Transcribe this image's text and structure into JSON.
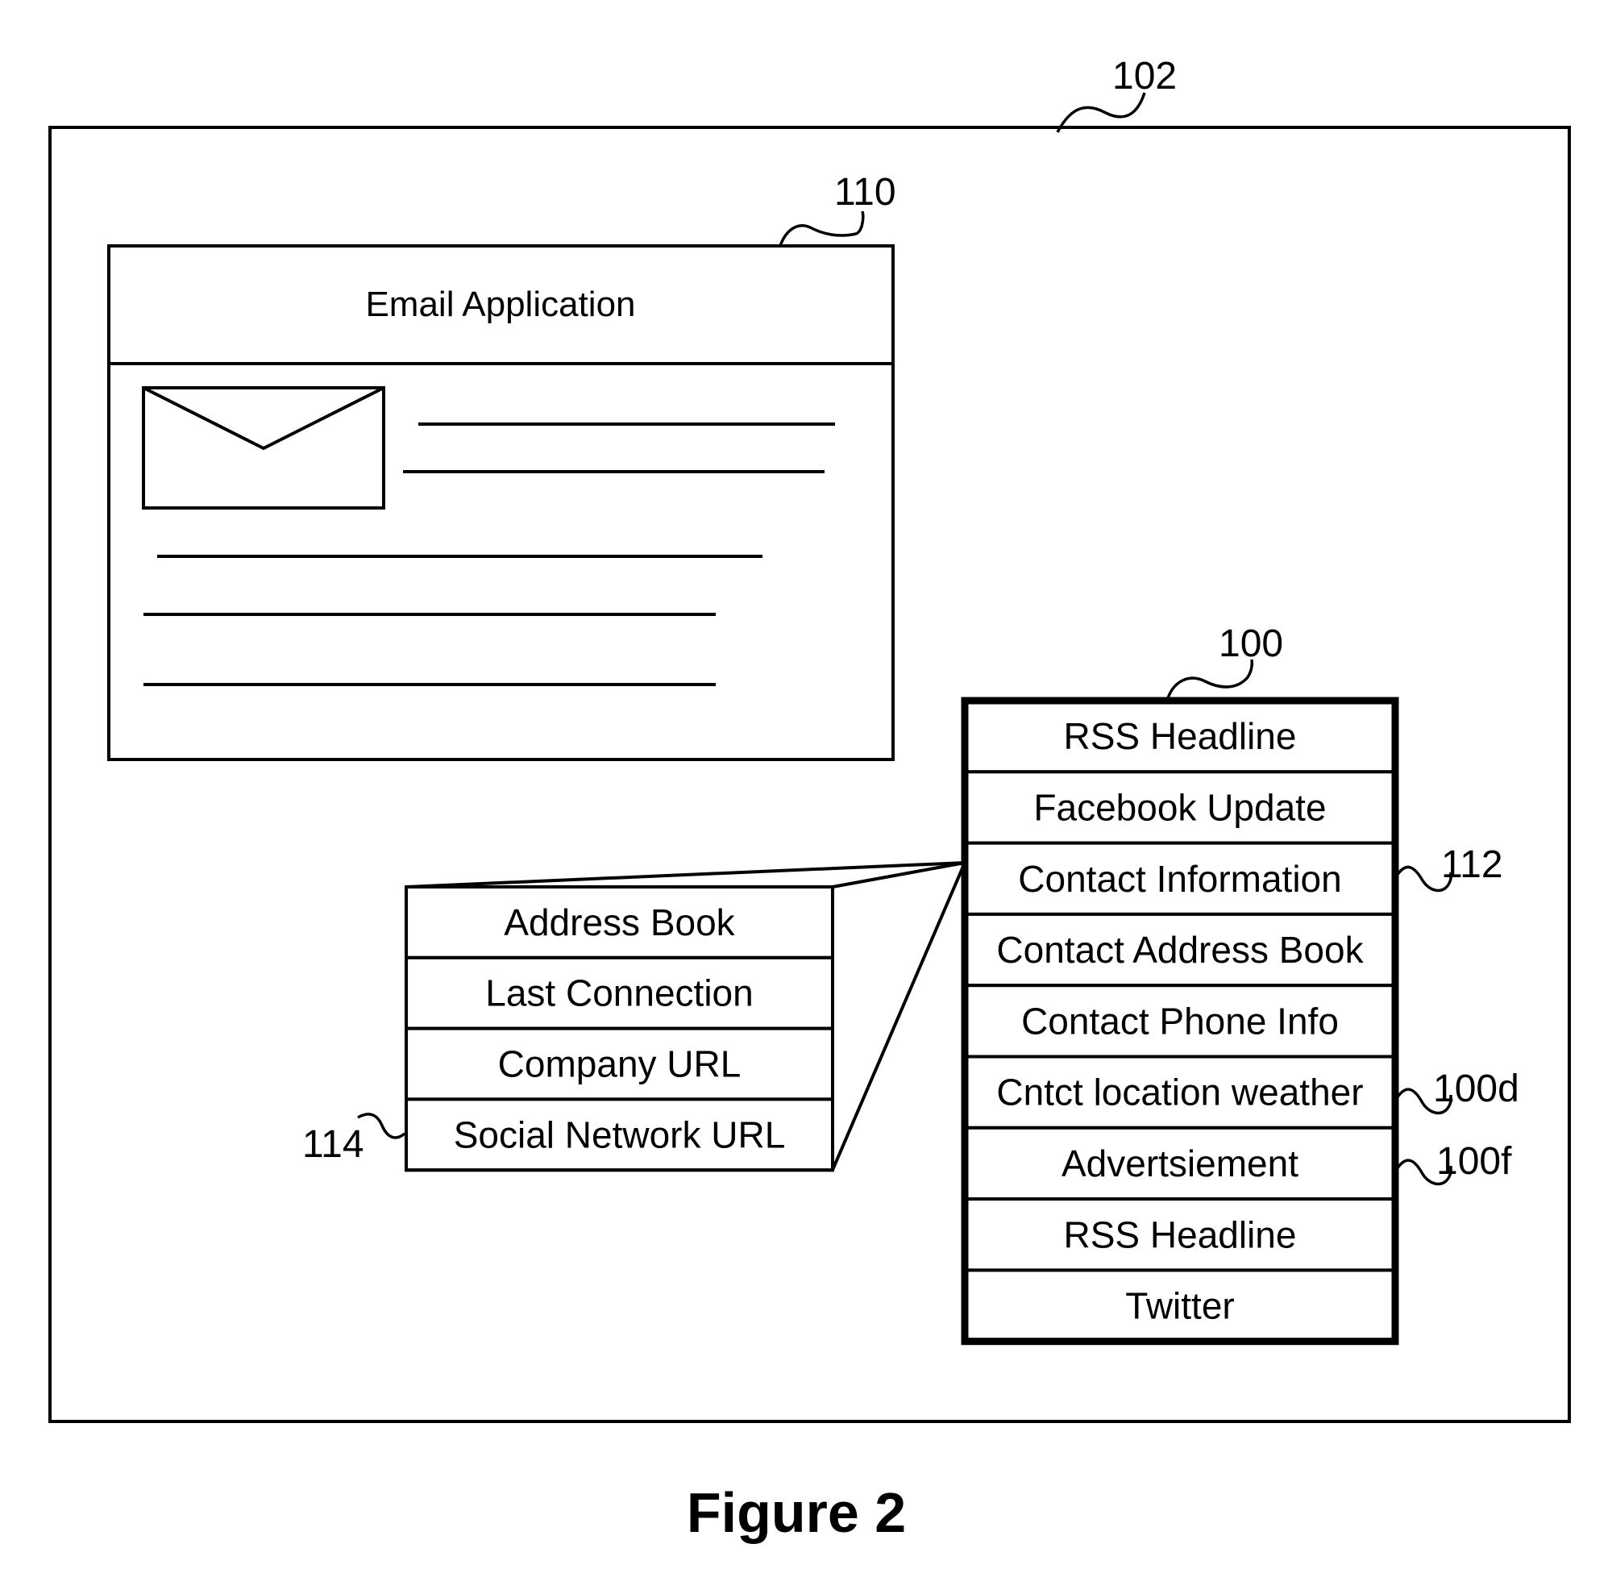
{
  "figure_caption": "Figure 2",
  "reference_numerals": {
    "screen": "102",
    "email_app": "110",
    "widget_panel": "100",
    "contact_info": "112",
    "contact_weather": "100d",
    "advertisement": "100f",
    "expanded_panel": "114"
  },
  "email_app": {
    "title": "Email Application",
    "icon": "envelope-icon"
  },
  "widget_panel": {
    "items": [
      "RSS Headline",
      "Facebook Update",
      "Contact Information",
      "Contact Address Book",
      "Contact Phone Info",
      "Cntct location weather",
      "Advertsiement",
      "RSS Headline",
      "Twitter"
    ]
  },
  "expanded_panel": {
    "items": [
      "Address Book",
      "Last Connection",
      "Company URL",
      "Social Network URL"
    ]
  }
}
